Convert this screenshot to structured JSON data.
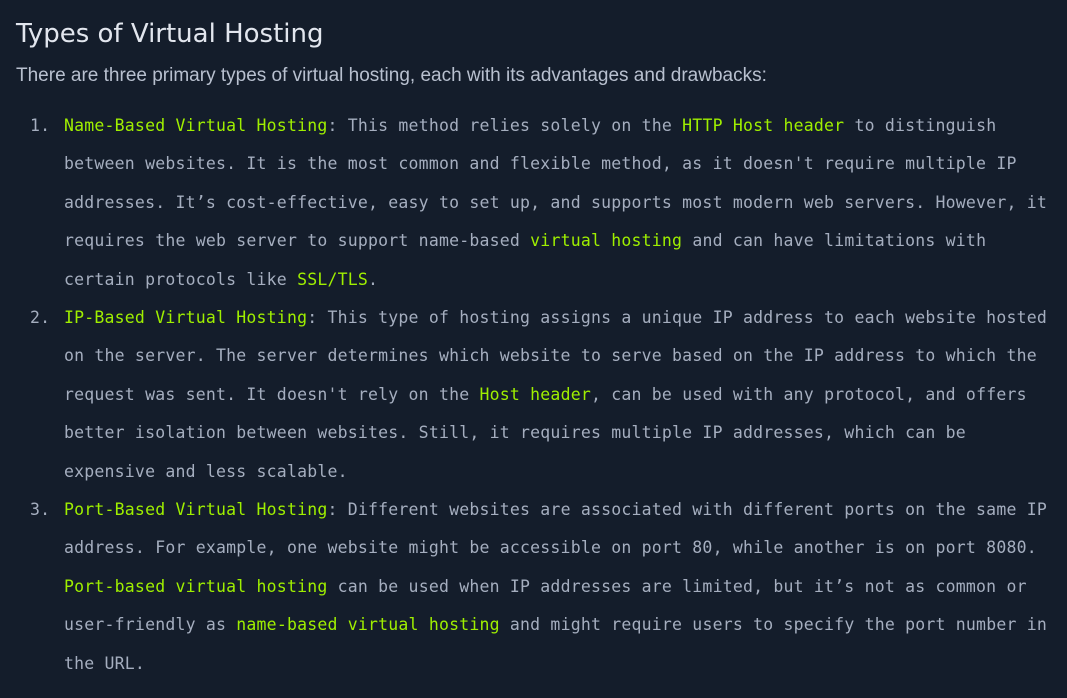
{
  "section": {
    "title": "Types of Virtual Hosting",
    "intro": "There are three primary types of virtual hosting, each with its advantages and drawbacks:"
  },
  "colors": {
    "background": "#141d2b",
    "text": "#a5aebf",
    "highlight": "#9fef00",
    "title": "#e2e6ee"
  },
  "types": [
    {
      "marker": "1.",
      "name": "Name-Based Virtual Hosting",
      "seg1": ": This method relies solely on the ",
      "hl1": "HTTP Host header",
      "seg2": " to distinguish between websites. It is the most common and flexible method, as it doesn't require multiple IP addresses. It’s cost-effective, easy to set up, and supports most modern web servers. However, it requires the web server to support name-based ",
      "hl2": "virtual hosting",
      "seg3": " and can have limitations with certain protocols like ",
      "hl3": "SSL/TLS",
      "seg4": "."
    },
    {
      "marker": "2.",
      "name": "IP-Based Virtual Hosting",
      "seg1": ": This type of hosting assigns a unique IP address to each website hosted on the server. The server determines which website to serve based on the IP address to which the request was sent. It doesn't rely on the ",
      "hl1": "Host header",
      "seg2": ", can be used with any protocol, and offers better isolation between websites. Still, it requires multiple IP addresses, which can be expensive and less scalable."
    },
    {
      "marker": "3.",
      "name": "Port-Based Virtual Hosting",
      "seg1": ": Different websites are associated with different ports on the same IP address. For example, one website might be accessible on port 80, while another is on port 8080. ",
      "hl1": "Port-based virtual hosting",
      "seg2": " can be used when IP addresses are limited, but it’s not as common or user-friendly as ",
      "hl2": "name-based virtual hosting",
      "seg3": " and might require users to specify the port number in the URL."
    }
  ]
}
